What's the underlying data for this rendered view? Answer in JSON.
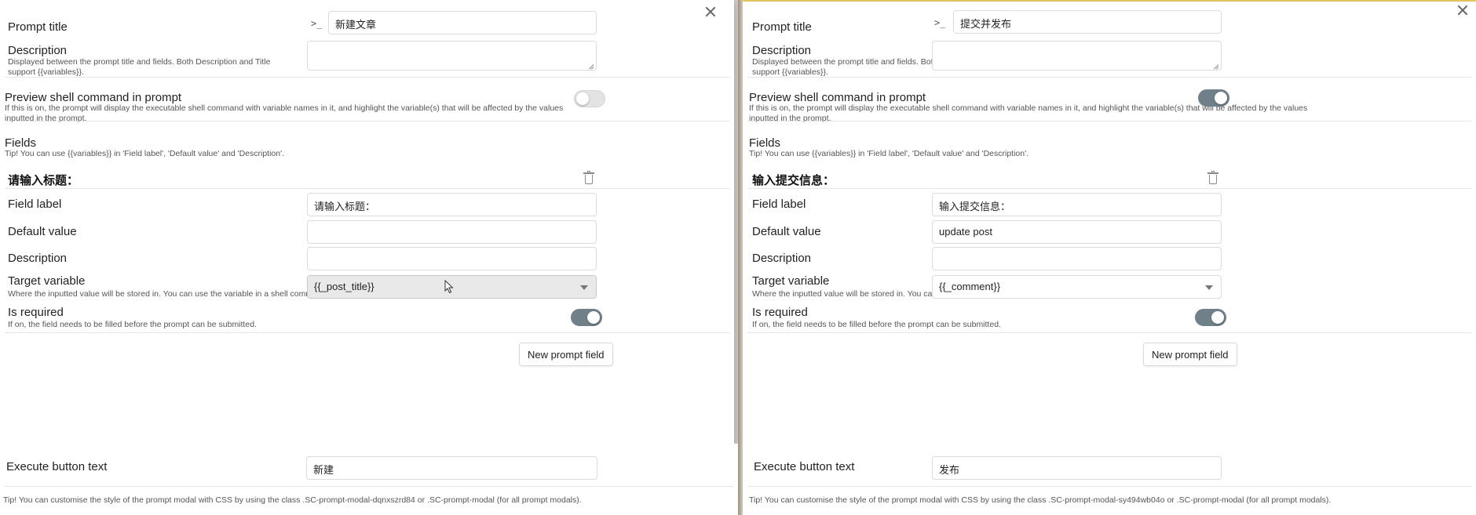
{
  "left": {
    "prompt_title_label": "Prompt title",
    "prompt_icon": ">_",
    "prompt_title_value": "新建文章",
    "description_label": "Description",
    "description_help": "Displayed between the prompt title and fields. Both Description and Title support {{variables}}.",
    "preview_label": "Preview shell command in prompt",
    "preview_help": "If this is on, the prompt will display the executable shell command with variable names in it, and highlight the variable(s) that will be affected by the values inputted in the prompt.",
    "preview_on": false,
    "fields_label": "Fields",
    "fields_help": "Tip! You can use {{variables}} in 'Field label', 'Default value' and 'Description'.",
    "field_heading": "请输入标题：",
    "field_label_label": "Field label",
    "field_label_value": "请输入标题：",
    "default_value_label": "Default value",
    "default_value_value": "",
    "field_description_label": "Description",
    "field_description_value": "",
    "target_variable_label": "Target variable",
    "target_variable_help": "Where the inputted value will be stored in. You can use the variable in a shell command.",
    "target_variable_value": "{{_post_title}}",
    "required_label": "Is required",
    "required_help": "If on, the field needs to be filled before the prompt can be submitted.",
    "required_on": true,
    "new_field_button": "New prompt field",
    "execute_label": "Execute button text",
    "execute_value": "新建",
    "css_tip": "Tip! You can customise the style of the prompt modal with CSS by using the class .SC-prompt-modal-dqnxszrd84 or .SC-prompt-modal (for all prompt modals)."
  },
  "right": {
    "prompt_title_label": "Prompt title",
    "prompt_icon": ">_",
    "prompt_title_value": "提交并发布",
    "description_label": "Description",
    "description_help": "Displayed between the prompt title and fields. Both Description and Title support {{variables}}.",
    "preview_label": "Preview shell command in prompt",
    "preview_help": "If this is on, the prompt will display the executable shell command with variable names in it, and highlight the variable(s) that will be affected by the values inputted in the prompt.",
    "preview_on": true,
    "fields_label": "Fields",
    "fields_help": "Tip! You can use {{variables}} in 'Field label', 'Default value' and 'Description'.",
    "field_heading": "输入提交信息：",
    "field_label_label": "Field label",
    "field_label_value": "输入提交信息：",
    "default_value_label": "Default value",
    "default_value_value": "update post",
    "field_description_label": "Description",
    "field_description_value": "",
    "target_variable_label": "Target variable",
    "target_variable_help": "Where the inputted value will be stored in. You can use the variable in a shell command.",
    "target_variable_value": "{{_comment}}",
    "required_label": "Is required",
    "required_help": "If on, the field needs to be filled before the prompt can be submitted.",
    "required_on": true,
    "new_field_button": "New prompt field",
    "execute_label": "Execute button text",
    "execute_value": "发布",
    "css_tip": "Tip! You can customise the style of the prompt modal with CSS by using the class .SC-prompt-modal-sy494wb04o or .SC-prompt-modal (for all prompt modals)."
  },
  "colors": {
    "toggle_on": "#6f8089",
    "toggle_off": "#e3e3e3",
    "accent_frame": "#f1cf64"
  }
}
